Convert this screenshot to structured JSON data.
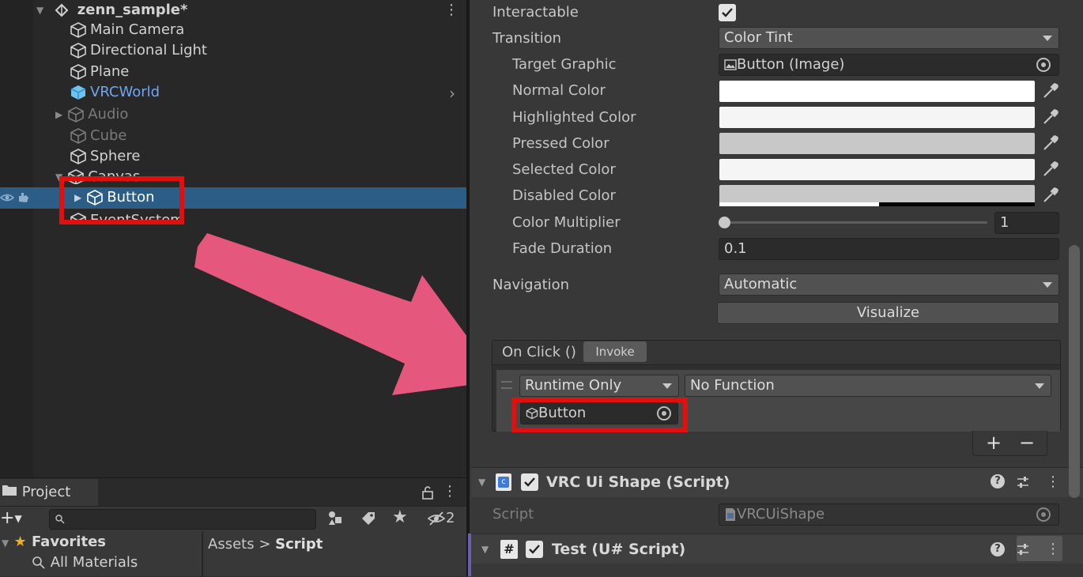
{
  "hierarchy": {
    "scene": "zenn_sample*",
    "items": [
      {
        "label": "Main Camera"
      },
      {
        "label": "Directional Light"
      },
      {
        "label": "Plane"
      },
      {
        "label": "VRCWorld"
      },
      {
        "label": "Audio"
      },
      {
        "label": "Cube"
      },
      {
        "label": "Sphere"
      },
      {
        "label": "Canvas"
      },
      {
        "label": "Button"
      },
      {
        "label": "EventSystem"
      }
    ]
  },
  "project": {
    "tab": "Project",
    "hidden_count": "2",
    "favorites": "Favorites",
    "all_materials": "All Materials",
    "breadcrumb": {
      "root": "Assets",
      "sep": ">",
      "current": "Script"
    }
  },
  "inspector": {
    "interactable": "Interactable",
    "transition": {
      "label": "Transition",
      "value": "Color Tint"
    },
    "target_graphic": {
      "label": "Target Graphic",
      "value": "Button (Image)"
    },
    "normal_color": {
      "label": "Normal Color",
      "color": "#ffffff"
    },
    "highlighted_color": {
      "label": "Highlighted Color",
      "color": "#f5f5f5"
    },
    "pressed_color": {
      "label": "Pressed Color",
      "color": "#c8c8c8"
    },
    "selected_color": {
      "label": "Selected Color",
      "color": "#f5f5f5"
    },
    "disabled_color": {
      "label": "Disabled Color",
      "color": "#c8c8c8"
    },
    "color_multiplier": {
      "label": "Color Multiplier",
      "value": "1",
      "slider_fraction": 0.0
    },
    "fade_duration": {
      "label": "Fade Duration",
      "value": "0.1"
    },
    "navigation": {
      "label": "Navigation",
      "value": "Automatic"
    },
    "visualize": "Visualize",
    "on_click": {
      "label": "On Click ()",
      "invoke": "Invoke",
      "call_state": "Runtime Only",
      "function": "No Function",
      "target": "Button"
    },
    "components": [
      {
        "title": "VRC Ui Shape (Script)",
        "script_label": "Script",
        "script_value": "VRCUiShape"
      },
      {
        "title": "Test (U# Script)"
      }
    ]
  }
}
